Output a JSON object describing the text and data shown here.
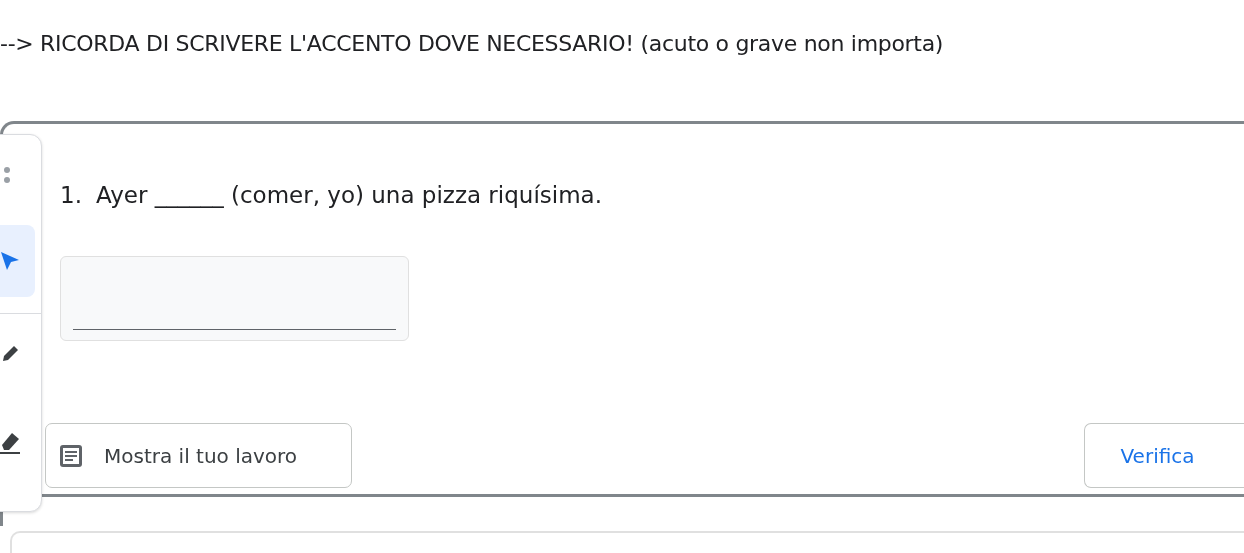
{
  "instruction": "--> RICORDA DI SCRIVERE L'ACCENTO DOVE NECESSARIO! (acuto o grave non importa)",
  "toolbar": {
    "tools": [
      {
        "kind": "pointer",
        "selected": true
      },
      {
        "kind": "pen",
        "selected": false
      },
      {
        "kind": "marker",
        "selected": false
      }
    ]
  },
  "question": {
    "number": "1.",
    "text": "Ayer ______ (comer, yo) una pizza riquísima."
  },
  "buttons": {
    "show_work": "Mostra il tuo lavoro",
    "check": "Verifica"
  }
}
